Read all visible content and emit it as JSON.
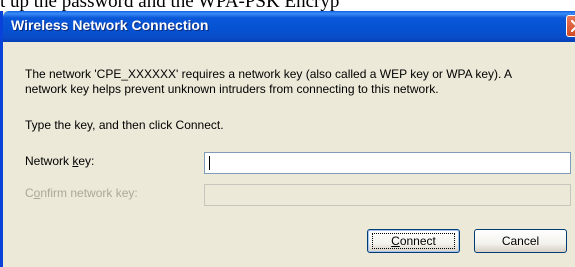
{
  "window": {
    "title": "Wireless Network Connection"
  },
  "background_text": "t up the password and the WPA-PSK Encryp",
  "message": {
    "line1": "The network 'CPE_XXXXXX' requires a network key (also called a WEP key or WPA key). A",
    "line2": "network key helps prevent unknown intruders from connecting to this network."
  },
  "instruction": "Type the key, and then click Connect.",
  "fields": {
    "network_key": {
      "label_pre": "Network ",
      "label_access": "k",
      "label_post": "ey:",
      "value": ""
    },
    "confirm_key": {
      "label_pre": "C",
      "label_access": "o",
      "label_post": "nfirm network key:",
      "value": ""
    }
  },
  "buttons": {
    "connect": {
      "label_access": "C",
      "label_rest": "onnect"
    },
    "cancel": {
      "label": "Cancel"
    }
  }
}
